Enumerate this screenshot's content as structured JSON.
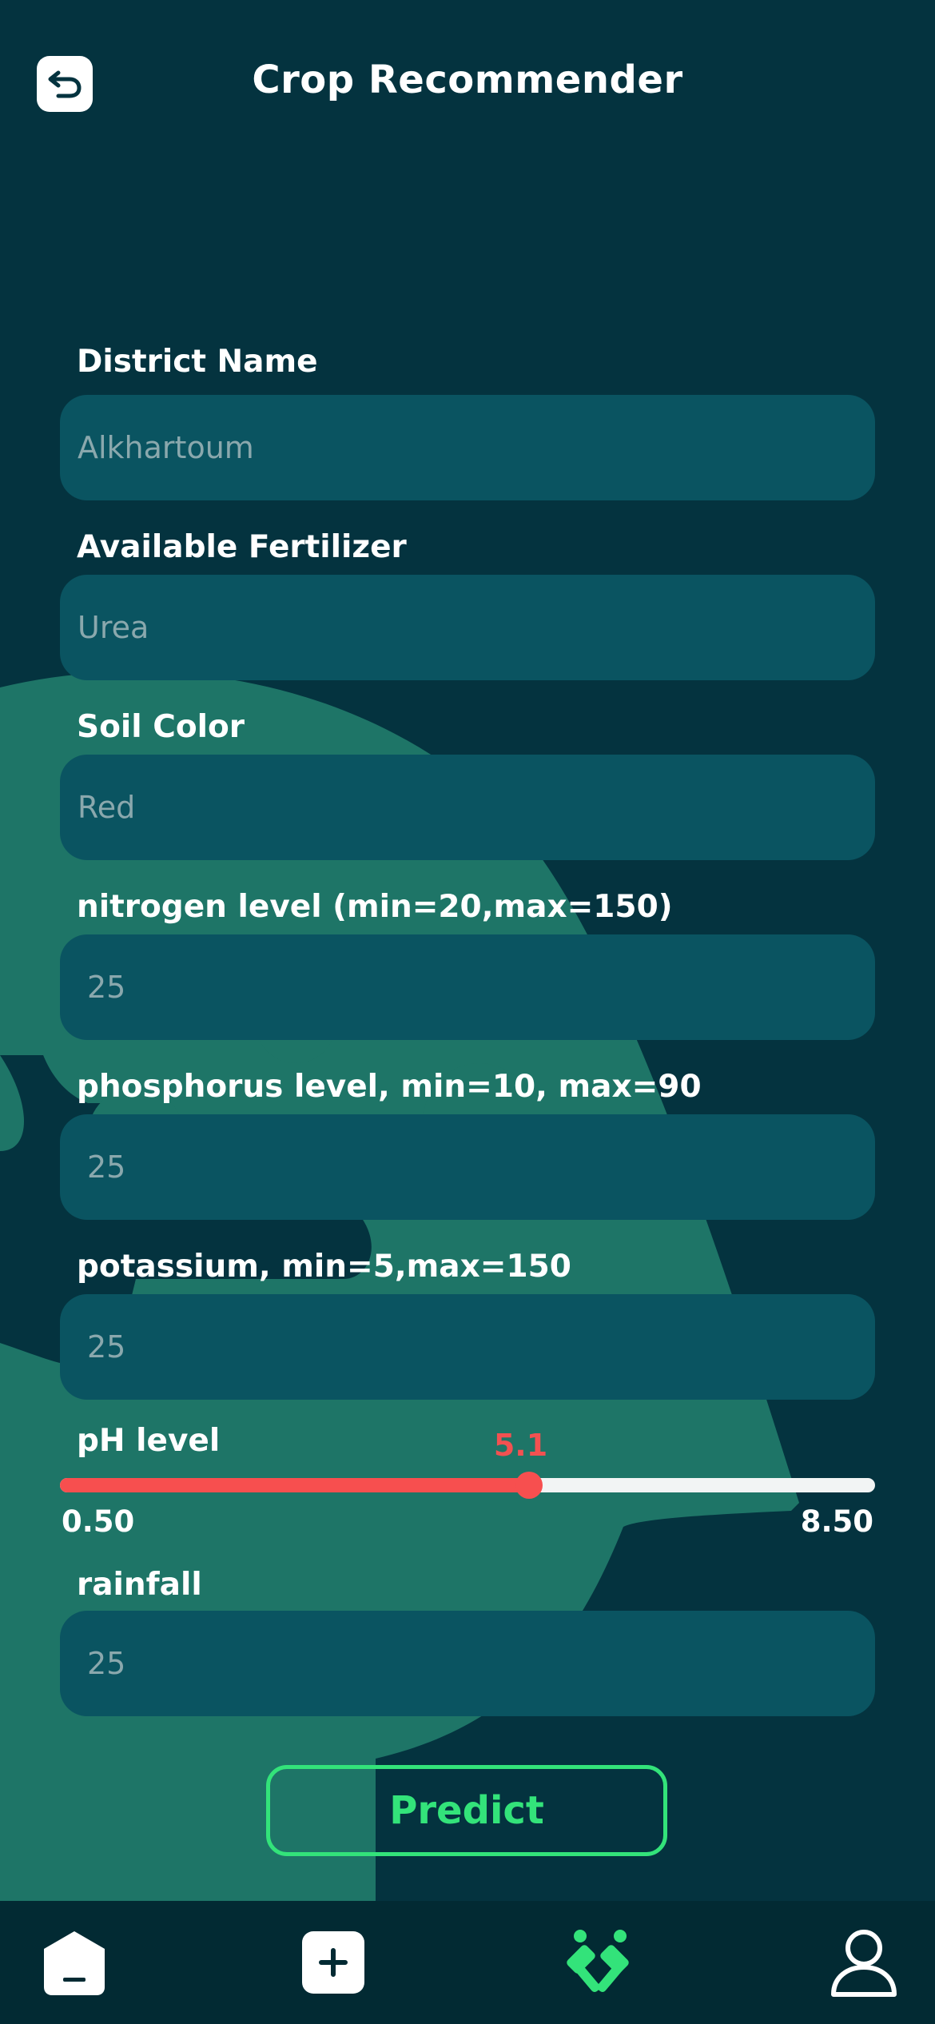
{
  "header": {
    "title": "Crop Recommender",
    "back_icon": "back-arrow-icon"
  },
  "form": {
    "district": {
      "label": "District Name",
      "placeholder": "Alkhartoum"
    },
    "fertilizer": {
      "label": "Available Fertilizer",
      "placeholder": "Urea"
    },
    "soil_color": {
      "label": "Soil Color",
      "placeholder": "Red"
    },
    "nitrogen": {
      "label": "nitrogen level (min=20,max=150)",
      "placeholder": "25"
    },
    "phosphorus": {
      "label": "phosphorus level, min=10, max=90",
      "placeholder": "25"
    },
    "potassium": {
      "label": "potassium, min=5,max=150",
      "placeholder": "25"
    },
    "ph": {
      "label": "pH level",
      "value": "5.1",
      "value_num": 5.1,
      "min_label": "0.50",
      "max_label": "8.50",
      "min": 0.5,
      "max": 8.5
    },
    "rainfall": {
      "label": "rainfall",
      "placeholder": "25"
    }
  },
  "actions": {
    "predict_label": "Predict"
  },
  "nav": {
    "items": [
      {
        "icon": "home-icon"
      },
      {
        "icon": "add-icon"
      },
      {
        "icon": "tools-icon",
        "active": true
      },
      {
        "icon": "profile-icon"
      }
    ]
  },
  "colors": {
    "background": "#04333f",
    "field": "#0a5461",
    "accent_green": "#33e37a",
    "slider_red": "#f74f4f",
    "decor_teal": "#1e7567"
  }
}
